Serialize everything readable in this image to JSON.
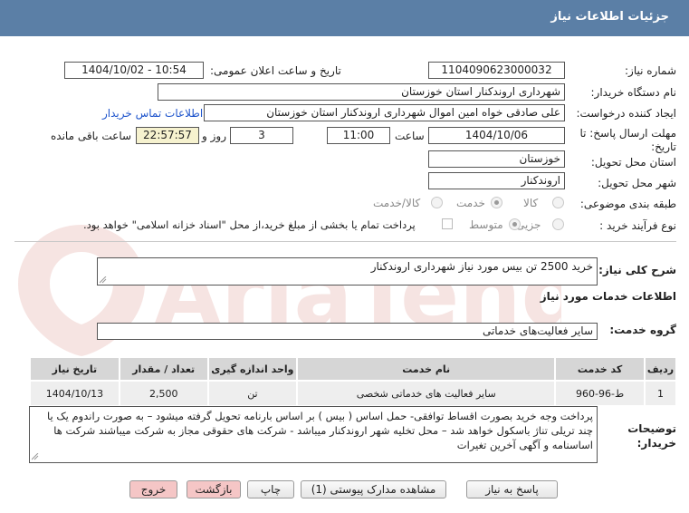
{
  "header": {
    "title": "جزئیات اطلاعات نیاز"
  },
  "form": {
    "need_number_label": "شماره نیاز:",
    "need_number": "1104090623000032",
    "announce_label": "تاریخ و ساعت اعلان عمومی:",
    "announce_value": "1404/10/02 - 10:54",
    "buyer_org_label": "نام دستگاه خریدار:",
    "buyer_org": "شهرداری اروندکنار استان خوزستان",
    "creator_label": "ایجاد کننده درخواست:",
    "creator": "علی صادقی خواه امین اموال شهرداری اروندکنار استان خوزستان",
    "contact_link": "اطلاعات تماس خریدار",
    "deadline_label_1": "مهلت ارسال پاسخ: تا",
    "deadline_label_2": "تاریخ:",
    "deadline_date": "1404/10/06",
    "time_label": "ساعت",
    "deadline_time": "11:00",
    "days_value": "3",
    "days_label": "روز و",
    "remaining_time": "22:57:57",
    "remaining_label": "ساعت باقی مانده",
    "province_label": "استان محل تحویل:",
    "province": "خوزستان",
    "city_label": "شهر محل تحویل:",
    "city": "اروندکنار",
    "category_label": "طبقه بندی موضوعی:",
    "category_options": [
      "کالا",
      "خدمت",
      "کالا/خدمت"
    ],
    "category_selected": "خدمت",
    "process_label": "نوع فرآیند خرید :",
    "process_options": [
      "جزیی",
      "متوسط"
    ],
    "process_selected": "متوسط",
    "payment_note": "پرداخت تمام یا بخشی از مبلغ خرید،از محل \"اسناد خزانه اسلامی\" خواهد بود."
  },
  "summary": {
    "label": "شرح کلی نیاز:",
    "value": "خرید 2500 تن بیس مورد نیاز شهرداری اروندکنار"
  },
  "services": {
    "section_title": "اطلاعات خدمات مورد نیاز",
    "group_label": "گروه خدمت:",
    "group_value": "سایر فعالیت‌های خدماتی",
    "columns": [
      "ردیف",
      "کد خدمت",
      "نام خدمت",
      "واحد اندازه گیری",
      "تعداد / مقدار",
      "تاریخ نیاز"
    ],
    "rows": [
      [
        "1",
        "ط-96-960",
        "سایر فعالیت های خدماتی شخصی",
        "تن",
        "2,500",
        "1404/10/13"
      ]
    ]
  },
  "buyer_notes": {
    "label_1": "توضیحات",
    "label_2": "خریدار:",
    "text": "پرداخت وجه خرید بصورت اقساط توافقی- حمل اساس ( بیس ) بر اساس بارنامه تحویل گرفته میشود – به صورت راندوم یک یا چند تریلی تناژ باسکول خواهد شد – محل تخلیه شهر اروندکنار میباشد -  شرکت های حقوقی مجاز به شرکت میباشند شرکت ها اساسنامه و آگهی آخرین تغیرات"
  },
  "buttons": {
    "reply": "پاسخ به نیاز",
    "attachments": "مشاهده مدارک پیوستی (1)",
    "print": "چاپ",
    "back": "بازگشت",
    "exit": "خروج"
  },
  "watermark": {
    "text": "AriaTender.neT",
    "color": "#c0392b"
  }
}
